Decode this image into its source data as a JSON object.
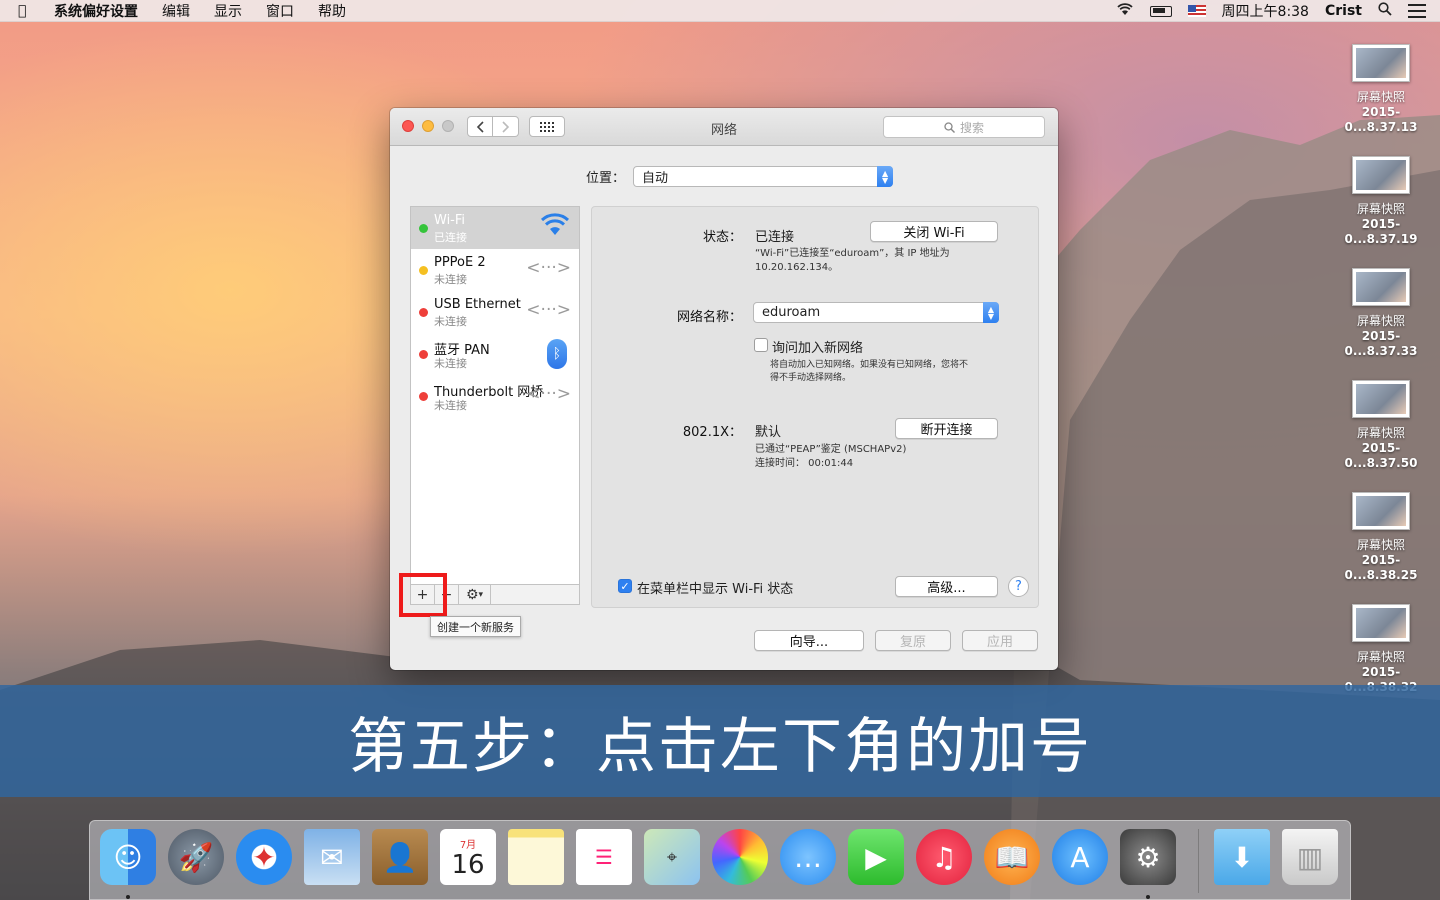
{
  "menubar": {
    "app_name": "系统偏好设置",
    "items": [
      "编辑",
      "显示",
      "窗口",
      "帮助"
    ],
    "clock": "周四上午8:38",
    "user": "Crist"
  },
  "desktop_icons": [
    {
      "name": "屏幕快照",
      "date": "2015-0...8.37.13"
    },
    {
      "name": "屏幕快照",
      "date": "2015-0...8.37.19"
    },
    {
      "name": "屏幕快照",
      "date": "2015-0...8.37.33"
    },
    {
      "name": "屏幕快照",
      "date": "2015-0...8.37.50"
    },
    {
      "name": "屏幕快照",
      "date": "2015-0...8.38.25"
    },
    {
      "name": "屏幕快照",
      "date": "2015-0...8.38.32"
    }
  ],
  "window": {
    "title": "网络",
    "search_placeholder": "搜索",
    "location_label": "位置：",
    "location_value": "自动",
    "services": [
      {
        "name": "Wi-Fi",
        "status": "已连接",
        "dot": "green",
        "icon": "wifi-icon"
      },
      {
        "name": "PPPoE 2",
        "status": "未连接",
        "dot": "yellow",
        "icon": "ethernet-arrows-icon"
      },
      {
        "name": "USB Ethernet",
        "status": "未连接",
        "dot": "red",
        "icon": "ethernet-arrows-icon"
      },
      {
        "name": "蓝牙 PAN",
        "status": "未连接",
        "dot": "red",
        "icon": "bluetooth-icon"
      },
      {
        "name": "Thunderbolt 网桥",
        "status": "未连接",
        "dot": "red",
        "icon": "ethernet-arrows-icon"
      }
    ],
    "add_button": "+",
    "remove_button": "−",
    "tooltip": "创建一个新服务",
    "detail": {
      "status_label": "状态：",
      "status_value": "已连接",
      "wifi_off_button": "关闭 Wi-Fi",
      "status_desc_line1": "“Wi-Fi”已连接至“eduroam”，其 IP 地址为",
      "status_desc_line2": "10.20.162.134。",
      "network_name_label": "网络名称：",
      "network_name_value": "eduroam",
      "ask_join_label": "询问加入新网络",
      "ask_join_desc_line1": "将自动加入已知网络。如果没有已知网络，您将不",
      "ask_join_desc_line2": "得不手动选择网络。",
      "dot1x_label": "802.1X：",
      "dot1x_value": "默认",
      "disconnect_button": "断开连接",
      "dot1x_desc_line1": "已通过“PEAP”鉴定 (MSCHAPv2)",
      "dot1x_desc_line2": "连接时间：  00:01:44",
      "show_wifi_status_label": "在菜单栏中显示 Wi-Fi 状态",
      "advanced_button": "高级...",
      "help_button": "?"
    },
    "assist_button": "向导...",
    "revert_button": "复原",
    "apply_button": "应用"
  },
  "banner_text": "第五步：点击左下角的加号",
  "dock_items": [
    "Finder",
    "Launchpad",
    "Safari",
    "Mail",
    "Contacts",
    "Calendar",
    "Notes",
    "Reminders",
    "Maps",
    "Photos",
    "Messages",
    "FaceTime",
    "iTunes",
    "iBooks",
    "App Store",
    "System Preferences",
    "Downloads",
    "Trash"
  ],
  "calendar_month": "7月",
  "calendar_day": "16"
}
